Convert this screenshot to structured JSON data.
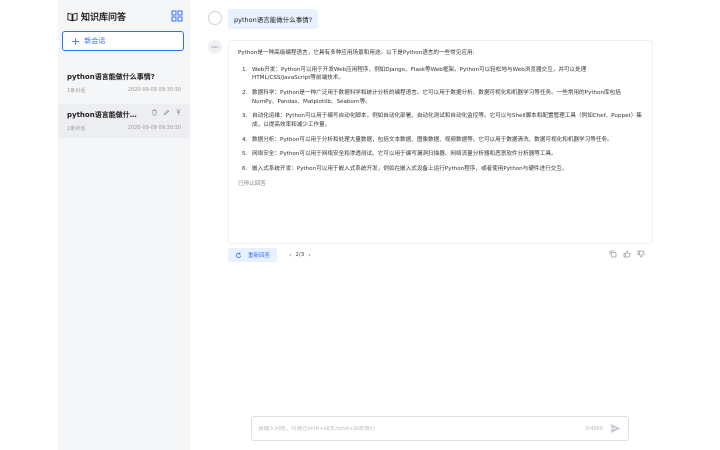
{
  "sidebar": {
    "title": "知识库问答",
    "new_chat_label": "新会话",
    "conversations": [
      {
        "title": "python语言能做什么事情?",
        "count": "1条对话",
        "time": "2020-09-09 09:30:30"
      },
      {
        "title": "python语言能做什么事情?",
        "count": "1条对话",
        "time": "2020-09-09 09:30:30"
      }
    ]
  },
  "chat": {
    "question": "python语言能做什么事情?",
    "assistant_avatar_text": "icon",
    "answer": {
      "intro": "Python是一种高级编程语言，它具有多种应用场景和用途。以下是Python语言的一些常见应用:",
      "items": [
        {
          "num": "1.",
          "text": "Web开发：Python可以用于开发Web应用程序，例如Django、Flask等Web框架。Python可以轻松地与Web浏览器交互，并可以处理HTML/CSS/JavaScript等前端技术。"
        },
        {
          "num": "2.",
          "text": "数据科学：Python是一种广泛用于数据科学和统计分析的编程语言。它可以用于数据分析、数据可视化和机器学习等任务。一些常用的Python库包括NumPy、Pandas、Matplotlib、Seaborn等。"
        },
        {
          "num": "3.",
          "text": "自动化运维：Python可以用于编写自动化脚本，例如自动化部署、自动化测试和自动化监控等。它可以与Shell脚本和配置管理工具（例如Chef、Puppet）集成，以提高效率和减少工作量。"
        },
        {
          "num": "4.",
          "text": "数据分析：Python可以用于分析和处理大量数据，包括文本数据、图像数据、视频数据等。它可以用于数据清洗、数据可视化和机器学习等任务。"
        },
        {
          "num": "5.",
          "text": "网络安全：Python可以用于网络安全和渗透测试。它可以用于编写漏洞扫描器、网络流量分析器和恶意软件分析器等工具。"
        },
        {
          "num": "6.",
          "text": "嵌入式系统开发：Python可以用于嵌入式系统开发，例如在嵌入式设备上运行Python程序，或者使用Python与硬件进行交互。"
        }
      ],
      "stopped": "已停止回答"
    },
    "regenerate_label": "重新回答",
    "pager": {
      "prev": "‹",
      "current": "2/3",
      "next": "›"
    }
  },
  "input": {
    "placeholder": "请输入问题，可通过shift+回车/cmd+回车换行",
    "counter": "0/4000"
  },
  "colors": {
    "accent": "#2f6fff",
    "bubble": "#e8f1ff",
    "sidebar_bg": "#f5f6f8"
  }
}
